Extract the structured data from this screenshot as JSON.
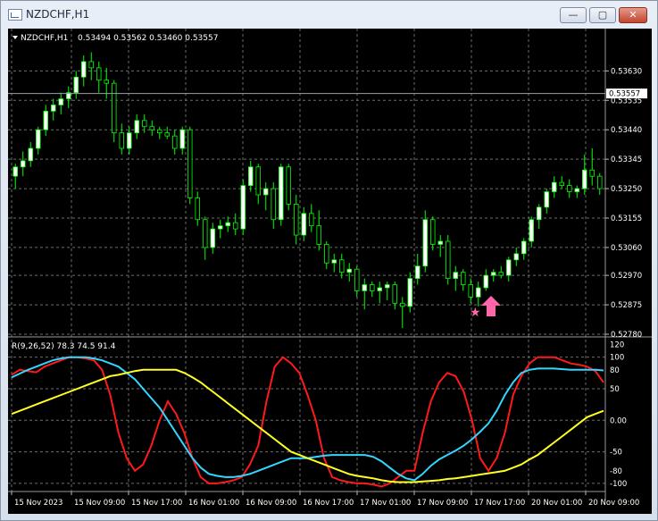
{
  "window": {
    "title": "NZDCHF,H1",
    "buttons": {
      "minimize": "—",
      "maximize": "▢",
      "close": "✕"
    }
  },
  "price_panel": {
    "symbol_label": "NZDCHF,H1",
    "ohlc": "0.53494 0.53562 0.53460 0.53557",
    "current_price": "0.53557",
    "y_ticks": [
      "0.53630",
      "0.53535",
      "0.53440",
      "0.53345",
      "0.53250",
      "0.53155",
      "0.53060",
      "0.52970",
      "0.52875",
      "0.52780"
    ]
  },
  "indicator_panel": {
    "label": "R(9,26,52) 78.3 74.5 91.4",
    "y_ticks": [
      "120",
      "100",
      "80",
      "50",
      "0.00",
      "-50",
      "-80",
      "-100"
    ]
  },
  "time_axis": [
    "15 Nov 2023",
    "15 Nov 09:00",
    "15 Nov 17:00",
    "16 Nov 01:00",
    "16 Nov 09:00",
    "16 Nov 17:00",
    "17 Nov 01:00",
    "17 Nov 09:00",
    "17 Nov 17:00",
    "20 Nov 01:00",
    "20 Nov 09:00"
  ],
  "colors": {
    "bull": "#ffffff",
    "bear": "#000000",
    "wick": "#00ff00",
    "fast_line": "#ff1a1a",
    "mid_line": "#33d6ff",
    "slow_line": "#ffff22",
    "signal": "#ff66aa",
    "grid": "#6e6e6e"
  },
  "chart_data": [
    {
      "type": "candlestick",
      "ylim": [
        0.5278,
        0.5368
      ],
      "last_price": 0.53557,
      "candles": [
        [
          0.5329,
          0.5333,
          0.5325,
          0.5332
        ],
        [
          0.5332,
          0.5337,
          0.5329,
          0.5334
        ],
        [
          0.5334,
          0.534,
          0.5332,
          0.5338
        ],
        [
          0.5338,
          0.5345,
          0.5336,
          0.5344
        ],
        [
          0.5344,
          0.5352,
          0.5342,
          0.535
        ],
        [
          0.535,
          0.5354,
          0.5347,
          0.5352
        ],
        [
          0.5352,
          0.5356,
          0.5349,
          0.5354
        ],
        [
          0.5354,
          0.5358,
          0.5351,
          0.5356
        ],
        [
          0.5356,
          0.5363,
          0.5354,
          0.5361
        ],
        [
          0.5361,
          0.5368,
          0.5358,
          0.5366
        ],
        [
          0.5366,
          0.5369,
          0.536,
          0.5364
        ],
        [
          0.5364,
          0.5366,
          0.5356,
          0.536
        ],
        [
          0.536,
          0.5364,
          0.5354,
          0.5359
        ],
        [
          0.5359,
          0.536,
          0.534,
          0.5343
        ],
        [
          0.5343,
          0.5346,
          0.5336,
          0.5338
        ],
        [
          0.5338,
          0.5345,
          0.5336,
          0.5343
        ],
        [
          0.5343,
          0.5349,
          0.5341,
          0.5347
        ],
        [
          0.5347,
          0.5349,
          0.5343,
          0.5345
        ],
        [
          0.5345,
          0.5347,
          0.5342,
          0.5344
        ],
        [
          0.5344,
          0.5345,
          0.5341,
          0.5343
        ],
        [
          0.5343,
          0.5345,
          0.5341,
          0.5342
        ],
        [
          0.5342,
          0.5344,
          0.5336,
          0.5338
        ],
        [
          0.5338,
          0.5345,
          0.5336,
          0.5344
        ],
        [
          0.5344,
          0.5345,
          0.532,
          0.5322
        ],
        [
          0.5322,
          0.5324,
          0.5313,
          0.5315
        ],
        [
          0.5315,
          0.5316,
          0.5302,
          0.5306
        ],
        [
          0.5306,
          0.5314,
          0.5304,
          0.5312
        ],
        [
          0.5312,
          0.5315,
          0.5309,
          0.5313
        ],
        [
          0.5313,
          0.5316,
          0.5311,
          0.5314
        ],
        [
          0.5314,
          0.5317,
          0.531,
          0.5312
        ],
        [
          0.5312,
          0.5328,
          0.531,
          0.5326
        ],
        [
          0.5326,
          0.5334,
          0.5324,
          0.5332
        ],
        [
          0.5332,
          0.5333,
          0.532,
          0.5323
        ],
        [
          0.5323,
          0.5327,
          0.5318,
          0.5325
        ],
        [
          0.5325,
          0.5327,
          0.5312,
          0.5315
        ],
        [
          0.5315,
          0.5333,
          0.5313,
          0.5332
        ],
        [
          0.5332,
          0.5333,
          0.5318,
          0.532
        ],
        [
          0.532,
          0.5323,
          0.5307,
          0.531
        ],
        [
          0.531,
          0.5319,
          0.5308,
          0.5317
        ],
        [
          0.5317,
          0.532,
          0.5311,
          0.5313
        ],
        [
          0.5313,
          0.5318,
          0.5305,
          0.5307
        ],
        [
          0.5307,
          0.5308,
          0.5299,
          0.5301
        ],
        [
          0.5301,
          0.5304,
          0.5298,
          0.5302
        ],
        [
          0.5302,
          0.5304,
          0.5296,
          0.5298
        ],
        [
          0.5298,
          0.5301,
          0.5295,
          0.5299
        ],
        [
          0.5299,
          0.53,
          0.529,
          0.5292
        ],
        [
          0.5292,
          0.5296,
          0.5286,
          0.5294
        ],
        [
          0.5294,
          0.5295,
          0.529,
          0.5292
        ],
        [
          0.5292,
          0.5295,
          0.5288,
          0.5293
        ],
        [
          0.5293,
          0.5295,
          0.5289,
          0.5294
        ],
        [
          0.5294,
          0.5295,
          0.5286,
          0.5288
        ],
        [
          0.5288,
          0.529,
          0.528,
          0.5287
        ],
        [
          0.5287,
          0.5298,
          0.5285,
          0.5296
        ],
        [
          0.5296,
          0.5304,
          0.5294,
          0.53
        ],
        [
          0.53,
          0.5318,
          0.5298,
          0.5315
        ],
        [
          0.5315,
          0.5316,
          0.5305,
          0.5307
        ],
        [
          0.5307,
          0.531,
          0.5303,
          0.5308
        ],
        [
          0.5308,
          0.531,
          0.5294,
          0.5296
        ],
        [
          0.5296,
          0.53,
          0.5292,
          0.5298
        ],
        [
          0.5298,
          0.5299,
          0.5292,
          0.5294
        ],
        [
          0.5294,
          0.5296,
          0.5288,
          0.529
        ],
        [
          0.529,
          0.5295,
          0.5287,
          0.5293
        ],
        [
          0.5293,
          0.5299,
          0.5292,
          0.5297
        ],
        [
          0.5297,
          0.5299,
          0.5295,
          0.5298
        ],
        [
          0.5298,
          0.53,
          0.5296,
          0.5297
        ],
        [
          0.5297,
          0.5303,
          0.5295,
          0.5302
        ],
        [
          0.5302,
          0.5306,
          0.53,
          0.5304
        ],
        [
          0.5304,
          0.5309,
          0.5302,
          0.5308
        ],
        [
          0.5308,
          0.5316,
          0.5306,
          0.5315
        ],
        [
          0.5315,
          0.532,
          0.5312,
          0.5319
        ],
        [
          0.5319,
          0.5325,
          0.5317,
          0.5324
        ],
        [
          0.5324,
          0.5329,
          0.5322,
          0.5327
        ],
        [
          0.5327,
          0.5329,
          0.5325,
          0.5326
        ],
        [
          0.5326,
          0.5328,
          0.5322,
          0.5324
        ],
        [
          0.5324,
          0.5326,
          0.5322,
          0.5325
        ],
        [
          0.5325,
          0.5336,
          0.5323,
          0.5331
        ],
        [
          0.5331,
          0.5338,
          0.5326,
          0.5329
        ],
        [
          0.5329,
          0.533,
          0.5323,
          0.5325
        ]
      ]
    },
    {
      "type": "line",
      "ylim": [
        -110,
        125
      ],
      "series": [
        {
          "values": [
            72,
            80,
            78,
            76,
            85,
            90,
            95,
            100,
            100,
            98,
            95,
            80,
            40,
            -20,
            -60,
            -80,
            -70,
            -40,
            0,
            30,
            10,
            -20,
            -60,
            -90,
            -100,
            -100,
            -98,
            -95,
            -90,
            -70,
            -40,
            30,
            85,
            100,
            90,
            75,
            40,
            0,
            -60,
            -90,
            -95,
            -98,
            -100,
            -100,
            -102,
            -105,
            -100,
            -90,
            -80,
            -80,
            -20,
            30,
            60,
            75,
            70,
            45,
            0,
            -60,
            -80,
            -60,
            -20,
            40,
            70,
            90,
            100,
            100,
            100,
            95,
            90,
            88,
            85,
            78,
            60
          ]
        },
        {
          "values": [
            68,
            74,
            80,
            85,
            90,
            95,
            98,
            100,
            100,
            100,
            98,
            95,
            90,
            85,
            75,
            65,
            50,
            35,
            20,
            0,
            -20,
            -40,
            -60,
            -75,
            -85,
            -88,
            -90,
            -90,
            -88,
            -85,
            -80,
            -75,
            -70,
            -65,
            -60,
            -60,
            -60,
            -58,
            -56,
            -55,
            -55,
            -55,
            -55,
            -55,
            -58,
            -65,
            -75,
            -85,
            -92,
            -95,
            -85,
            -72,
            -62,
            -55,
            -48,
            -40,
            -30,
            -18,
            -5,
            15,
            40,
            60,
            75,
            80,
            82,
            82,
            82,
            81,
            80,
            80,
            80,
            80,
            79
          ]
        },
        {
          "values": [
            10,
            15,
            20,
            25,
            30,
            35,
            40,
            45,
            50,
            55,
            60,
            65,
            70,
            72,
            75,
            78,
            80,
            80,
            80,
            80,
            80,
            75,
            68,
            60,
            50,
            40,
            30,
            20,
            10,
            0,
            -10,
            -20,
            -30,
            -40,
            -50,
            -55,
            -60,
            -65,
            -70,
            -75,
            -80,
            -85,
            -88,
            -90,
            -92,
            -95,
            -97,
            -98,
            -98,
            -98,
            -97,
            -96,
            -95,
            -93,
            -92,
            -90,
            -88,
            -86,
            -84,
            -82,
            -80,
            -75,
            -70,
            -62,
            -55,
            -45,
            -35,
            -25,
            -15,
            -5,
            5,
            10,
            15
          ]
        }
      ]
    }
  ]
}
